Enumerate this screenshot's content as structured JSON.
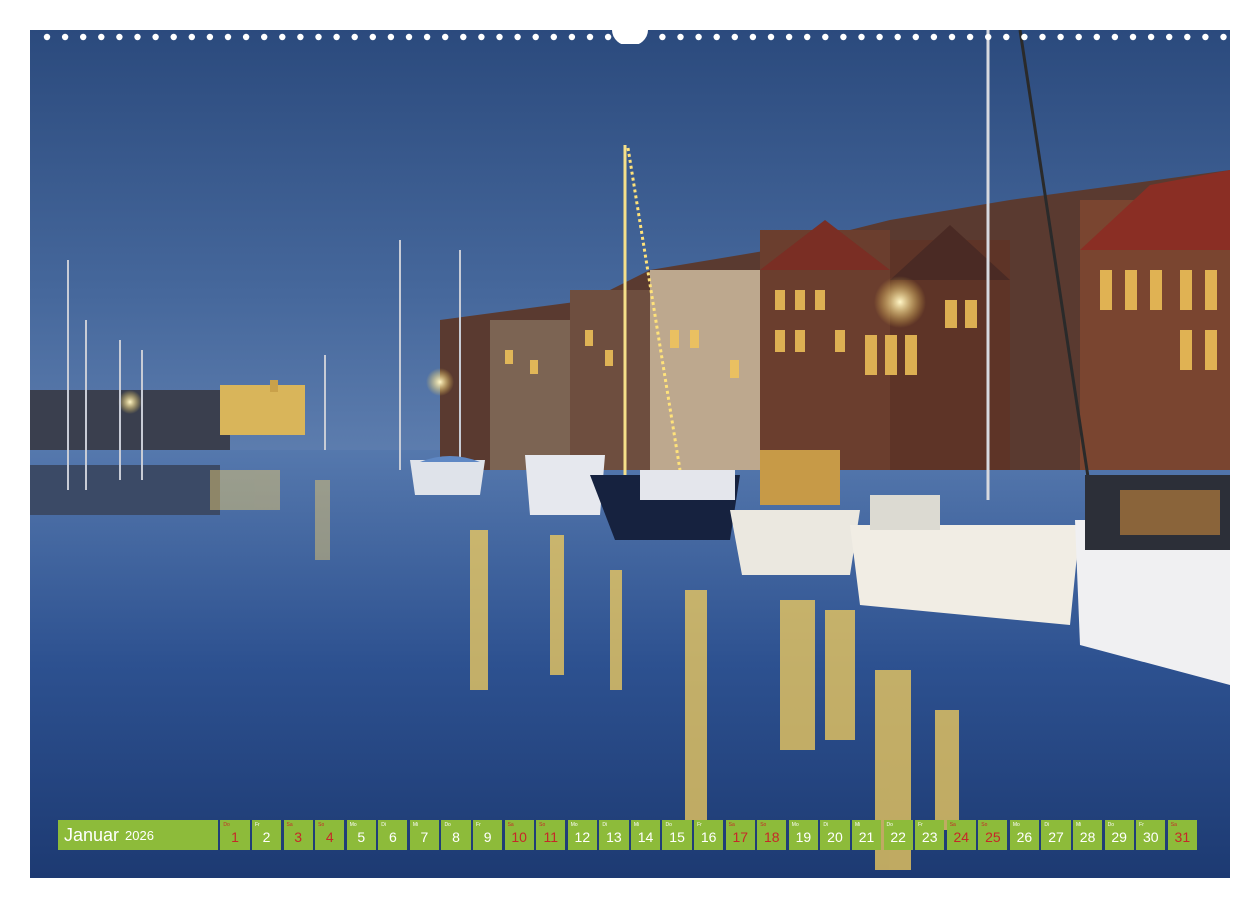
{
  "calendar": {
    "month": "Januar",
    "year": "2026",
    "days": [
      {
        "abbr": "Do",
        "num": "1",
        "weekend": true
      },
      {
        "abbr": "Fr",
        "num": "2",
        "weekend": false
      },
      {
        "abbr": "Sa",
        "num": "3",
        "weekend": true
      },
      {
        "abbr": "So",
        "num": "4",
        "weekend": true
      },
      {
        "abbr": "Mo",
        "num": "5",
        "weekend": false
      },
      {
        "abbr": "Di",
        "num": "6",
        "weekend": false
      },
      {
        "abbr": "Mi",
        "num": "7",
        "weekend": false
      },
      {
        "abbr": "Do",
        "num": "8",
        "weekend": false
      },
      {
        "abbr": "Fr",
        "num": "9",
        "weekend": false
      },
      {
        "abbr": "Sa",
        "num": "10",
        "weekend": true
      },
      {
        "abbr": "So",
        "num": "11",
        "weekend": true
      },
      {
        "abbr": "Mo",
        "num": "12",
        "weekend": false
      },
      {
        "abbr": "Di",
        "num": "13",
        "weekend": false
      },
      {
        "abbr": "Mi",
        "num": "14",
        "weekend": false
      },
      {
        "abbr": "Do",
        "num": "15",
        "weekend": false
      },
      {
        "abbr": "Fr",
        "num": "16",
        "weekend": false
      },
      {
        "abbr": "Sa",
        "num": "17",
        "weekend": true
      },
      {
        "abbr": "So",
        "num": "18",
        "weekend": true
      },
      {
        "abbr": "Mo",
        "num": "19",
        "weekend": false
      },
      {
        "abbr": "Di",
        "num": "20",
        "weekend": false
      },
      {
        "abbr": "Mi",
        "num": "21",
        "weekend": false
      },
      {
        "abbr": "Do",
        "num": "22",
        "weekend": false
      },
      {
        "abbr": "Fr",
        "num": "23",
        "weekend": false
      },
      {
        "abbr": "Sa",
        "num": "24",
        "weekend": true
      },
      {
        "abbr": "So",
        "num": "25",
        "weekend": true
      },
      {
        "abbr": "Mo",
        "num": "26",
        "weekend": false
      },
      {
        "abbr": "Di",
        "num": "27",
        "weekend": false
      },
      {
        "abbr": "Mi",
        "num": "28",
        "weekend": false
      },
      {
        "abbr": "Do",
        "num": "29",
        "weekend": false
      },
      {
        "abbr": "Fr",
        "num": "30",
        "weekend": false
      },
      {
        "abbr": "Sa",
        "num": "31",
        "weekend": true
      }
    ]
  },
  "colors": {
    "bar_green": "#8dbb3a",
    "weekend_red": "#c62828",
    "sky": "#2c4f83"
  }
}
